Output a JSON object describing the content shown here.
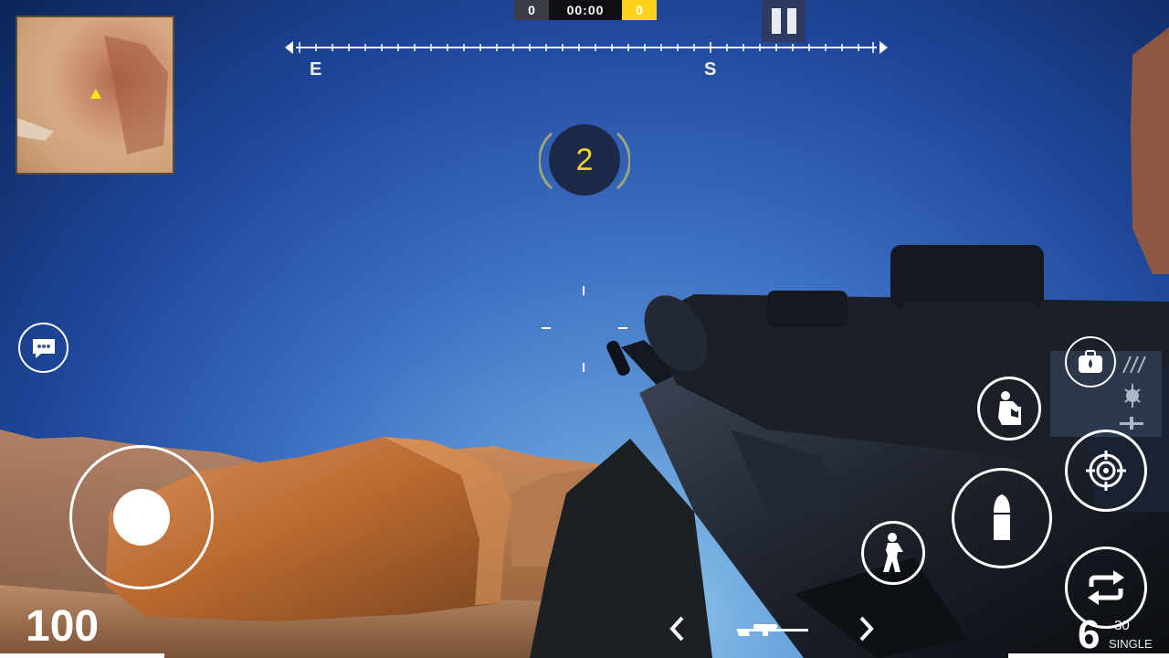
{
  "hud": {
    "score_left": "0",
    "timer": "00:00",
    "score_right": "0",
    "compass": {
      "east": "E",
      "south": "S"
    },
    "kills": "2",
    "health": "100",
    "ammo_clip": "6",
    "ammo_reserve": "30",
    "fire_mode": "SINGLE"
  },
  "icons": {
    "pause": "pause-icon",
    "chat": "chat-bubble-icon",
    "medkit": "medkit-icon",
    "crouch": "crouch-icon",
    "stand": "stand-icon",
    "scope": "scope-icon",
    "fire": "bullet-icon",
    "reload": "reload-icon",
    "weapon": "sniper-rifle-icon",
    "prev": "chevron-left-icon",
    "next": "chevron-right-icon"
  },
  "colors": {
    "accent_yellow": "#ffd21c",
    "kill_number": "#f4d52a",
    "hud_white": "#ffffff"
  }
}
